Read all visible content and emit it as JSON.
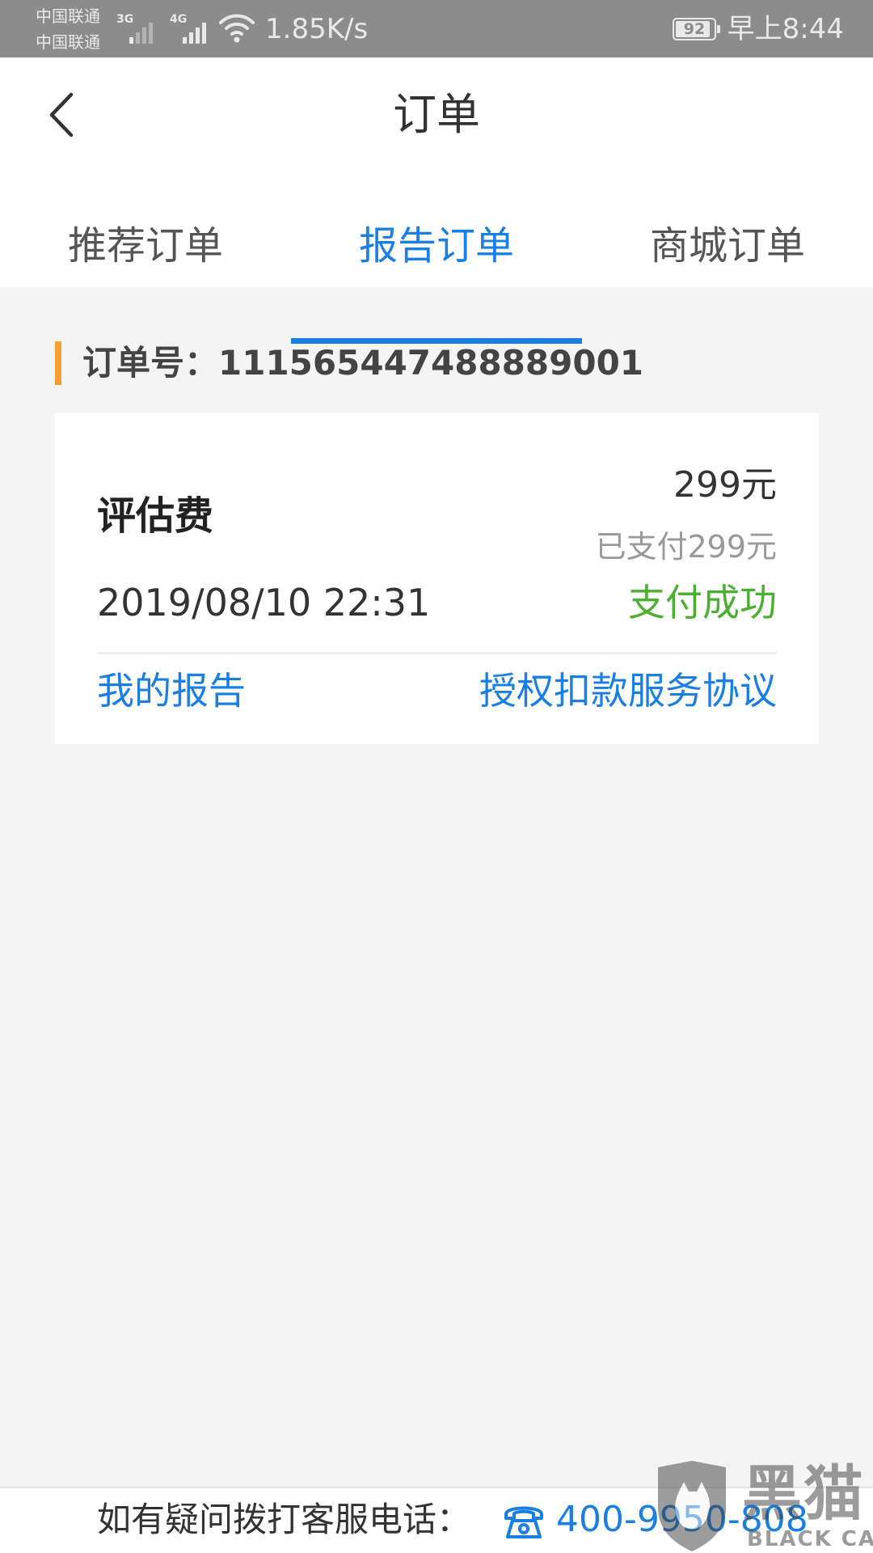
{
  "status_bar": {
    "carrier_1": "中国联通",
    "carrier_2": "中国联通",
    "net_type_1": "3G",
    "net_type_2": "4G",
    "signal_1_level": 0.2,
    "signal_2_level": 1.0,
    "net_speed": "1.85K/s",
    "battery_text": "92",
    "battery_level": 0.92,
    "time": "早上8:44"
  },
  "header": {
    "back_icon": "chevron-left-icon",
    "title": "订单"
  },
  "tabs": [
    {
      "label": "推荐订单",
      "active": false
    },
    {
      "label": "报告订单",
      "active": true
    },
    {
      "label": "商城订单",
      "active": false
    }
  ],
  "order": {
    "number": "订单号：1115654474888890​01",
    "item_name": "评估费",
    "price": "299元",
    "paid": "已支付299元",
    "time": "2019/08/10 22:31",
    "status": "支付成功",
    "my_report_link": "我的报告",
    "agreement_link": "授权扣款服务协议"
  },
  "footer": {
    "hotline_label": "如有疑问拨打客服电话：",
    "phone_icon": "phone-icon",
    "phone_number": "400-9950-808"
  },
  "watermark": {
    "text": "黑猫",
    "subtext": "BLACK CAT"
  },
  "colors": {
    "status_bar": "#8c8c8c",
    "accent_blue": "#1a7fe3",
    "order_accent": "#f5a030",
    "success_green": "#4caf30",
    "page_background": "#f4f4f4"
  }
}
